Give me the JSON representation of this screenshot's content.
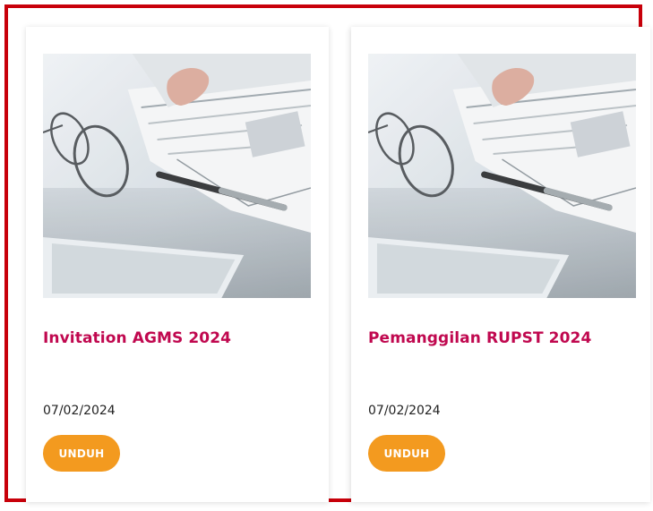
{
  "theme": {
    "frame_border": "#c8000a",
    "title_color": "#c0084f",
    "button_color": "#f39a1f",
    "button_text_color": "#ffffff"
  },
  "documents": [
    {
      "image": "newspaper-reading-photo",
      "title": "Invitation AGMS 2024",
      "date": "07/02/2024",
      "download_label": "UNDUH"
    },
    {
      "image": "newspaper-reading-photo",
      "title": "Pemanggilan RUPST 2024",
      "date": "07/02/2024",
      "download_label": "UNDUH"
    }
  ]
}
